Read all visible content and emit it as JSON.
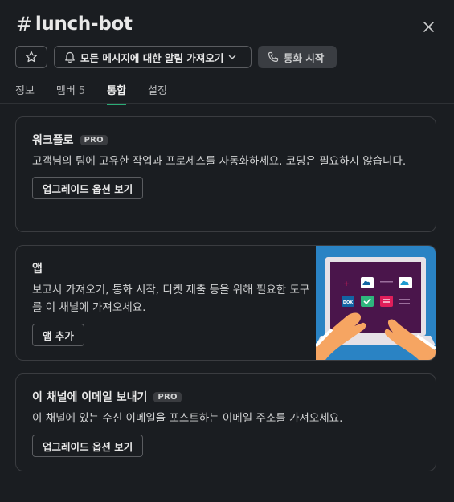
{
  "header": {
    "hash": "#",
    "channel_name": "lunch-bot",
    "notif_label": "모든 메시지에 대한 알림 가져오기",
    "call_label": "통화 시작"
  },
  "tabs": [
    {
      "label": "정보",
      "count": ""
    },
    {
      "label": "멤버",
      "count": "5"
    },
    {
      "label": "통합",
      "count": ""
    },
    {
      "label": "설정",
      "count": ""
    }
  ],
  "cards": {
    "workflow": {
      "title": "워크플로",
      "badge": "PRO",
      "desc": "고객님의 팀에 고유한 작업과 프로세스를 자동화하세요. 코딩은 필요하지 않습니다.",
      "button": "업그레이드 옵션 보기"
    },
    "apps": {
      "title": "앱",
      "desc": "보고서 가져오기, 통화 시작, 티켓 제출 등을 위해 필요한 도구를 이 채널에 가져오세요.",
      "button": "앱 추가",
      "illus_label": "DOK"
    },
    "email": {
      "title": "이 채널에 이메일 보내기",
      "badge": "PRO",
      "desc": "이 채널에 있는 수신 이메일을 포스트하는 이메일 주소를 가져오세요.",
      "button": "업그레이드 옵션 보기"
    }
  },
  "colors": {
    "background": "#1a1d21",
    "active_tab_underline": "#2bac76",
    "illustration_bg": "#2a83c4"
  }
}
